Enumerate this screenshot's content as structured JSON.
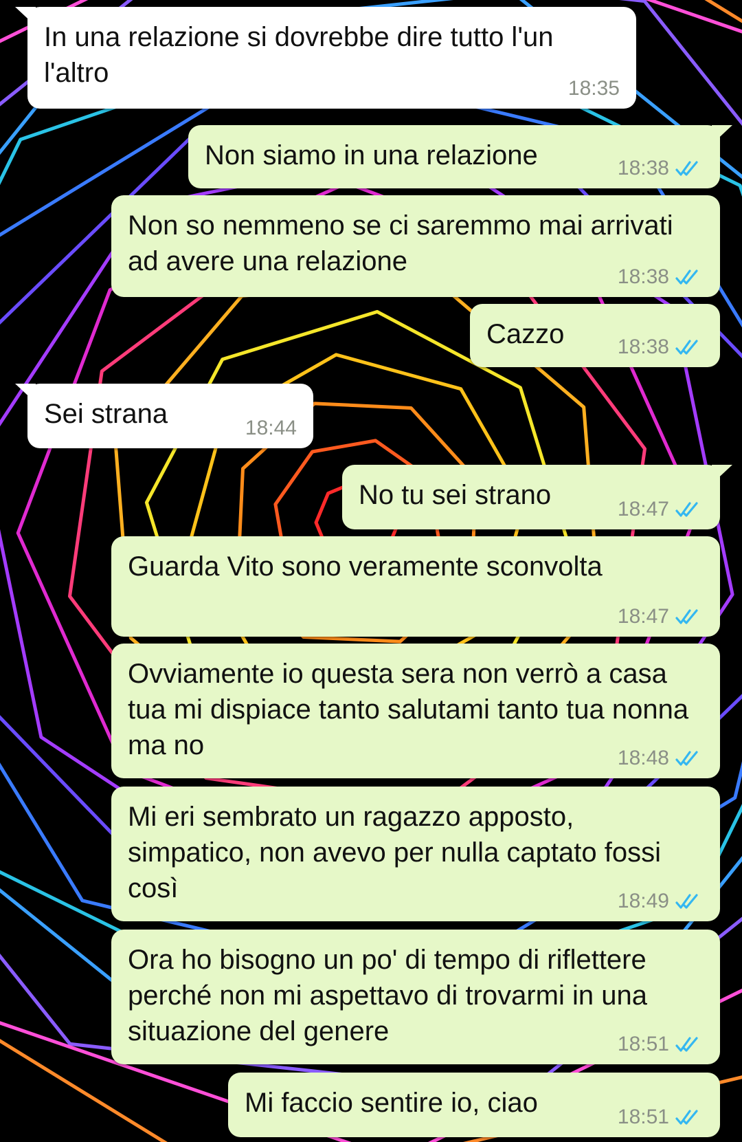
{
  "theme": {
    "incoming_color": "#ffffff",
    "outgoing_color": "#e6f8c8",
    "timestamp_color": "#8a8f86",
    "read_check_color": "#34b7f1"
  },
  "messages": [
    {
      "direction": "in",
      "text": "In una relazione si dovrebbe dire tutto l'un l'altro",
      "time": "18:35"
    },
    {
      "direction": "out",
      "text": "Non siamo in una relazione",
      "time": "18:38",
      "status": "read-double-check-icon"
    },
    {
      "direction": "out",
      "text": "Non so nemmeno se ci saremmo mai arrivati ad avere una relazione",
      "time": "18:38",
      "status": "read-double-check-icon"
    },
    {
      "direction": "out",
      "text": "Cazzo",
      "time": "18:38",
      "status": "read-double-check-icon"
    },
    {
      "direction": "in",
      "text": "Sei strana",
      "time": "18:44"
    },
    {
      "direction": "out",
      "text": "No tu sei strano",
      "time": "18:47",
      "status": "read-double-check-icon"
    },
    {
      "direction": "out",
      "text": "Guarda Vito sono veramente sconvolta",
      "time": "18:47",
      "status": "read-double-check-icon"
    },
    {
      "direction": "out",
      "text": "Ovviamente io questa sera non verrò a casa tua mi dispiace tanto salutami tanto tua nonna ma no",
      "time": "18:48",
      "status": "read-double-check-icon"
    },
    {
      "direction": "out",
      "text": "Mi eri sembrato un ragazzo apposto, simpatico, non avevo per nulla captato fossi così",
      "time": "18:49",
      "status": "read-double-check-icon"
    },
    {
      "direction": "out",
      "text": "Ora ho bisogno un po' di tempo di riflettere perché non mi aspettavo di trovarmi in una situazione del genere",
      "time": "18:51",
      "status": "read-double-check-icon"
    },
    {
      "direction": "out",
      "text": "Mi faccio sentire io, ciao",
      "time": "18:51",
      "status": "read-double-check-icon"
    }
  ]
}
